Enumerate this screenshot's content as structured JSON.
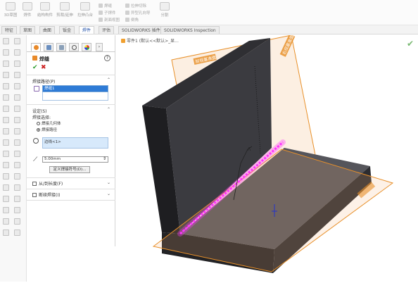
{
  "ribbon": {
    "buttons": [
      "3D草图",
      "焊件",
      "结构构件",
      "剪裁/延伸",
      "拉伸凸台",
      "焊缝",
      "子焊件",
      "剖面视图",
      "分割",
      "圆角焊缝"
    ],
    "small_items": [
      "拉伸切除",
      "异型孔向导",
      "倒角"
    ]
  },
  "tabs": {
    "items": [
      "特征",
      "草图",
      "曲面",
      "钣金",
      "焊件",
      "评估",
      "SOLIDWORKS 插件",
      "SOLIDWORKS Inspection"
    ],
    "active_index": 4
  },
  "property_manager": {
    "title": "焊缝",
    "ok_symbol": "✔",
    "cancel_symbol": "✖",
    "help_symbol": "?",
    "weld_path_label": "焊接路径(P)",
    "weld_path_value": "焊缝1",
    "settings_label": "设定(S)",
    "weld_select_label": "焊接选择:",
    "radio_geometry": "焊接几何体",
    "radio_path": "焊接路径",
    "edge_value": "边线<1>",
    "size_value": "5.00mm",
    "define_button": "定义焊接符号(D)...",
    "from_to_label": "从/到长度(F)",
    "intermittent_label": "断续焊接(I)",
    "chevron_up": "⌃",
    "chevron_down": "⌄",
    "arrows_symbol": "⇕"
  },
  "viewport": {
    "breadcrumb": "零件1 (默认<<默认>_显...",
    "plane_front_label": "前视基准面",
    "plane_right_label": "右视基准面",
    "accept_symbol": "✔"
  },
  "colors": {
    "weld_bead": "#ff33ff",
    "plane": "#e8902a",
    "accept": "#79b972",
    "solid_dark": "#3b3b3f"
  }
}
